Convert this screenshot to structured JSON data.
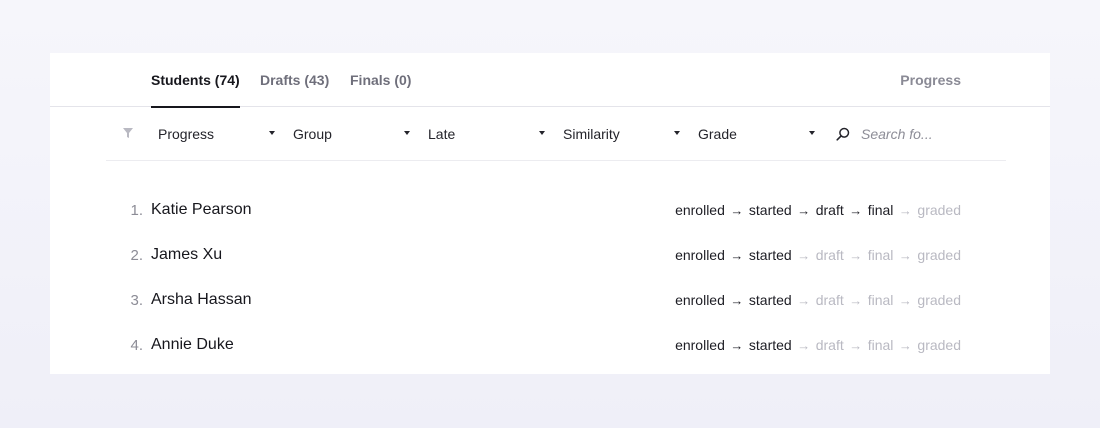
{
  "tabs": [
    {
      "label": "Students (74)",
      "active": true
    },
    {
      "label": "Drafts (43)",
      "active": false
    },
    {
      "label": "Finals (0)",
      "active": false
    }
  ],
  "header": {
    "progress_label": "Progress"
  },
  "filters": {
    "items": [
      {
        "label": "Progress"
      },
      {
        "label": "Group"
      },
      {
        "label": "Late"
      },
      {
        "label": "Similarity"
      },
      {
        "label": "Grade"
      }
    ],
    "search_placeholder": "Search fo..."
  },
  "students": [
    {
      "index": "1.",
      "name": "Katie Pearson",
      "completed_stages": 4
    },
    {
      "index": "2.",
      "name": "James Xu",
      "completed_stages": 2
    },
    {
      "index": "3.",
      "name": "Arsha Hassan",
      "completed_stages": 2
    },
    {
      "index": "4.",
      "name": "Annie Duke",
      "completed_stages": 2
    }
  ],
  "stages": [
    "enrolled",
    "started",
    "draft",
    "final",
    "graded"
  ],
  "colors": {
    "active": "#1d1d24",
    "inactive": "#b9b9c2",
    "background": "#f3f3fa"
  }
}
